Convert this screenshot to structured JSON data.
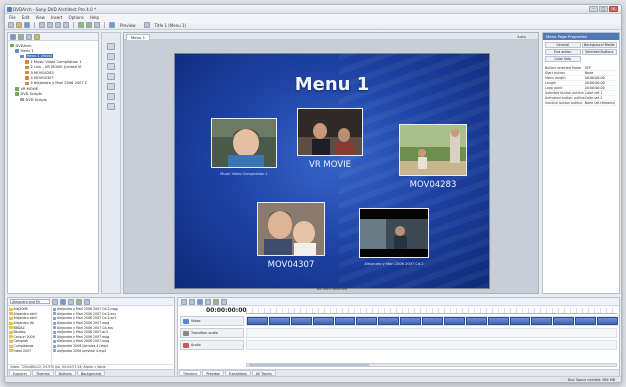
{
  "window": {
    "title": "DVDArch - Sony DVD Architect Pro 4.0 *"
  },
  "menu": [
    "File",
    "Edit",
    "View",
    "Insert",
    "Options",
    "Help"
  ],
  "toolbar": {
    "preview_label": "Preview",
    "title_label": "Title 1 (Menu 1)"
  },
  "project_tree": [
    {
      "label": "DVDArch",
      "level": 0,
      "color": "#7aa35c",
      "selected": false
    },
    {
      "label": "Menu 1",
      "level": 1,
      "color": "#5f8ed0",
      "selected": false
    },
    {
      "label": "Menu 1 (Main)",
      "level": 2,
      "color": "#5f8ed0",
      "selected": true
    },
    {
      "label": "1 Music Video Compilation 1",
      "level": 3,
      "color": "#d18a3c",
      "selected": false
    },
    {
      "label": "2 Link - VR MOVIE (Linked Vi",
      "level": 3,
      "color": "#d18a3c",
      "selected": false
    },
    {
      "label": "3 MOV04283",
      "level": 3,
      "color": "#d18a3c",
      "selected": false
    },
    {
      "label": "4 MOV04307",
      "level": 3,
      "color": "#d18a3c",
      "selected": false
    },
    {
      "label": "5 Alejandro y Mari 2006 2007 C",
      "level": 3,
      "color": "#d18a3c",
      "selected": false
    },
    {
      "label": "VR MOVIE",
      "level": 1,
      "color": "#7aa35c",
      "selected": false
    },
    {
      "label": "DVD Scripts",
      "level": 1,
      "color": "#7aa35c",
      "selected": false
    },
    {
      "label": "DVD Scripts",
      "level": 2,
      "color": "#a0a0a0",
      "selected": false
    }
  ],
  "editor": {
    "tab_label": "Menu 1",
    "zoom_label": "Auto",
    "status_text": "No item selected"
  },
  "menu_page": {
    "title": "Menu 1",
    "buttons": [
      {
        "caption": "Music Video Compilation 1",
        "caption_size": "small"
      },
      {
        "caption": "VR MOVIE",
        "caption_size": "big"
      },
      {
        "caption": "MOV04283",
        "caption_size": "big"
      },
      {
        "caption": "MOV04307",
        "caption_size": "big"
      },
      {
        "caption": "Alejandro y Mari 2006 2007 Cd.2",
        "caption_size": "small"
      }
    ]
  },
  "properties": {
    "header": "Menu Page Properties",
    "buttons": [
      "General",
      "Background Media",
      "End action",
      "Selected Buttons",
      "Color Sets",
      ""
    ],
    "rows": [
      {
        "key": "Button selected Mode",
        "value": "OFF"
      },
      {
        "key": "Start button",
        "value": "None"
      },
      {
        "key": "Menu length",
        "value": "00:00:00:00"
      },
      {
        "key": "Length",
        "value": "00:00:00:00"
      },
      {
        "key": "Loop point",
        "value": "00:00:00:00"
      },
      {
        "key": "Selected button outline",
        "value": "Color set 1"
      },
      {
        "key": "Activated button outline",
        "value": "Color set 2"
      },
      {
        "key": "Inactive button outline",
        "value": "None (all ttlmains)"
      }
    ]
  },
  "explorer": {
    "path": "Alejandro and Mi",
    "folders": [
      "Alej2006",
      "Alejandro abril",
      "Alejandro abril",
      "Alejandro dic",
      "BBDAZ",
      "Bautizo",
      "Cancun 2006",
      "Compras",
      "Cumpleanos",
      "Fotos 2007"
    ],
    "files": [
      "Alejandro y Mari 2006 2007 Cd.2.mpg",
      "Alejandro y Mari 2006 2007 Cd.2.avs",
      "Alejandro y Mari 2006 2007 Cd.2.ac3",
      "Alejandro y Mari 2006 2007.mpg",
      "Alejandro y Mari 2006 2007 Cd.avs",
      "Alejandro y Mari 2006 2007.ac3",
      "Alejandro y Mari 2006 2007.mpg",
      "Alejandro y Mari 2006 2007.mpg",
      "Alejandro 2006 (Jorrales 4).mp4",
      "Alejandro 2006 preview 4.mp4"
    ],
    "info": "Video: 720x480x12, 29.970 fps, 00:04:57:16, Alpha = None",
    "tabs": [
      "Explorer",
      "Themes",
      "Buttons",
      "Background"
    ]
  },
  "timeline": {
    "timecode": "00:00:00:00",
    "tracks": [
      {
        "name": "Video",
        "color": "#5b86d2"
      },
      {
        "name": "Transition audio",
        "color": "#8a8a8a"
      },
      {
        "name": "Audio",
        "color": "#c55a5a"
      }
    ],
    "clip_count": 17,
    "tabs": [
      "Timeline",
      "Preview",
      "Transitions",
      "All Tracks"
    ]
  },
  "statusbar": {
    "text": "Disc Space needed: 984 MB"
  }
}
